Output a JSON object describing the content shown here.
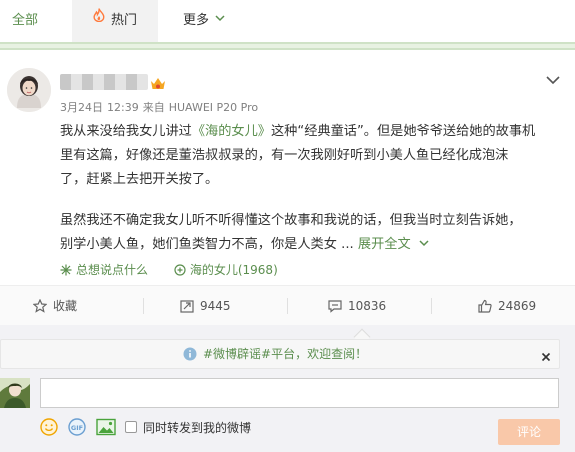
{
  "tabs": {
    "all": "全部",
    "hot": "热门",
    "more": "更多"
  },
  "post": {
    "meta": {
      "date": "3月24日",
      "time": "12:39",
      "source_prefix": "来自",
      "device": "HUAWEI P20 Pro"
    },
    "paragraph1": {
      "line1_a": "我从来没给我女儿讲过",
      "line1_link": "《海的女儿》",
      "line1_b": "这种“经典童话”。但是她爷爷送给她的故事机",
      "line2": "里有这篇，好像还是董浩叔叔录的，有一次我刚好听到小美人鱼已经化成泡沫",
      "line3": "了，赶紧上去把开关按了。"
    },
    "paragraph2": {
      "line1": "虽然我还不确定我女儿听不听得懂这个故事和我说的话，但我当时立刻告诉她，",
      "line2": "别学小美人鱼，她们鱼类智力不高，你是人类女 ...",
      "expand": "展开全文"
    },
    "tags": {
      "topic1": "总想说点什么",
      "topic2": "海的女儿(1968)"
    }
  },
  "actions": {
    "favorite": "收藏",
    "forward": "9445",
    "comment": "10836",
    "like": "24869"
  },
  "comment_area": {
    "notice": "#微博辟谣#平台，欢迎查阅！",
    "checkbox_label": "同时转发到我的微博",
    "submit": "评论",
    "gif_label": "GIF"
  },
  "colors": {
    "accent_green": "#5b8e4e",
    "submit_disabled": "#f9c8a9",
    "flame": "#ff7a3d",
    "vip": "#f5a623"
  }
}
